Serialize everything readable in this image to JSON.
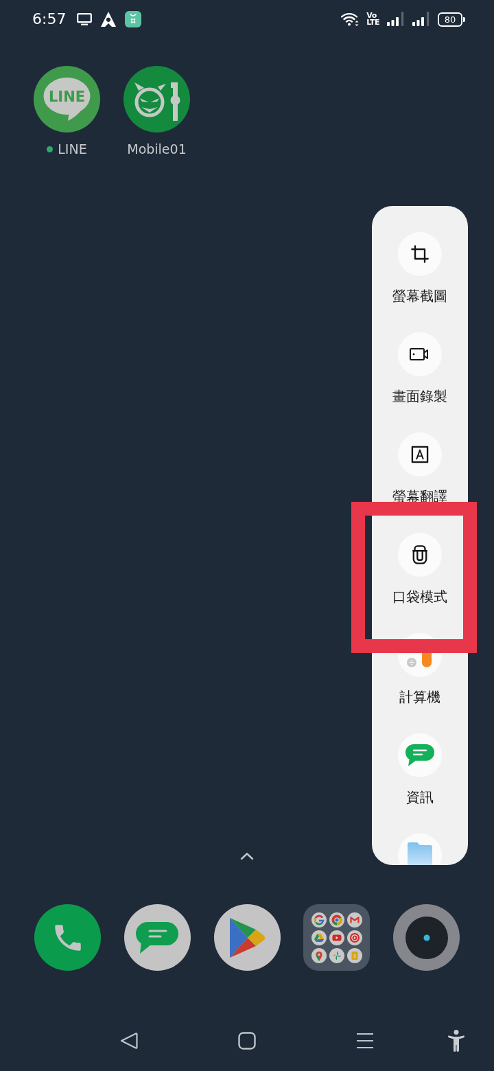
{
  "status_bar": {
    "time": "6:57",
    "volte": [
      "Vo",
      "LTE"
    ],
    "battery": "80"
  },
  "home_apps": [
    {
      "name": "LINE",
      "logo_text": "LINE",
      "new": true
    },
    {
      "name": "Mobile01",
      "new": false
    }
  ],
  "side_panel": {
    "items": [
      {
        "label": "螢幕截圖",
        "highlighted": false
      },
      {
        "label": "畫面錄製",
        "highlighted": false
      },
      {
        "label": "螢幕翻譯",
        "highlighted": false
      },
      {
        "label": "口袋模式",
        "highlighted": true
      },
      {
        "label": "計算機",
        "highlighted": false
      },
      {
        "label": "資訊",
        "highlighted": false
      }
    ]
  }
}
